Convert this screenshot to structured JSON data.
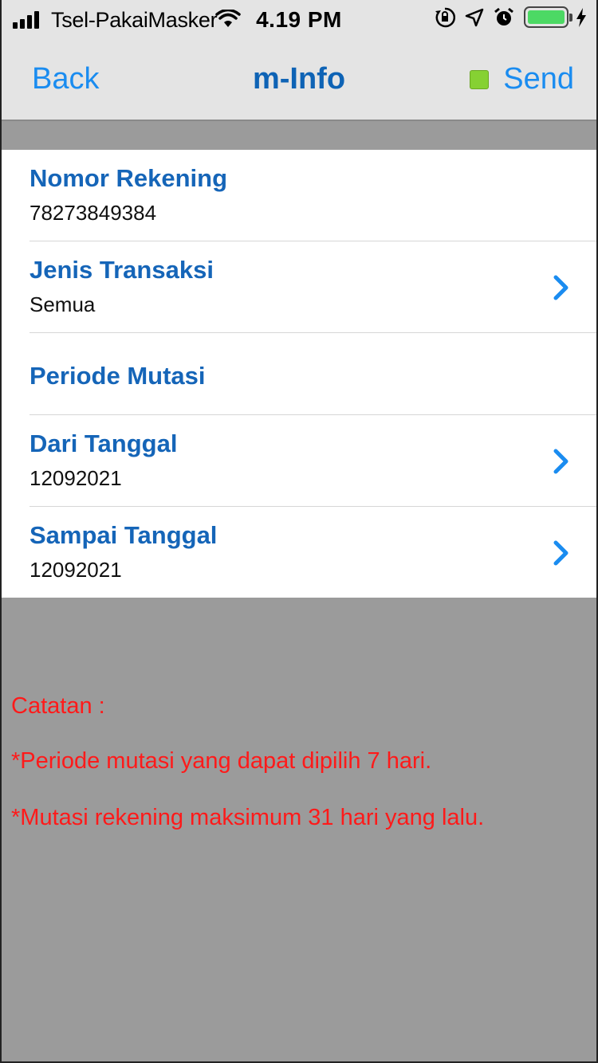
{
  "status_bar": {
    "carrier": "Tsel-PakaiMasker",
    "time": "4.19 PM",
    "battery_color": "#4cd964"
  },
  "nav": {
    "back_label": "Back",
    "title": "m-Info",
    "send_label": "Send",
    "send_indicator_color": "#86d133"
  },
  "form": {
    "rows": [
      {
        "title": "Nomor Rekening",
        "value": "78273849384"
      },
      {
        "title": "Jenis Transaksi",
        "value": "Semua"
      },
      {
        "title": "Periode Mutasi"
      },
      {
        "title": "Dari Tanggal",
        "value": "12092021"
      },
      {
        "title": "Sampai Tanggal",
        "value": "12092021"
      }
    ]
  },
  "notes": {
    "title": "Catatan :",
    "lines": [
      "*Periode mutasi yang dapat dipilih 7 hari.",
      "*Mutasi rekening maksimum 31 hari yang lalu."
    ]
  },
  "colors": {
    "accent": "#1a8cf0",
    "title_blue": "#1565b8",
    "note_red": "#ff1a1a",
    "background_gray": "#9b9b9b"
  }
}
